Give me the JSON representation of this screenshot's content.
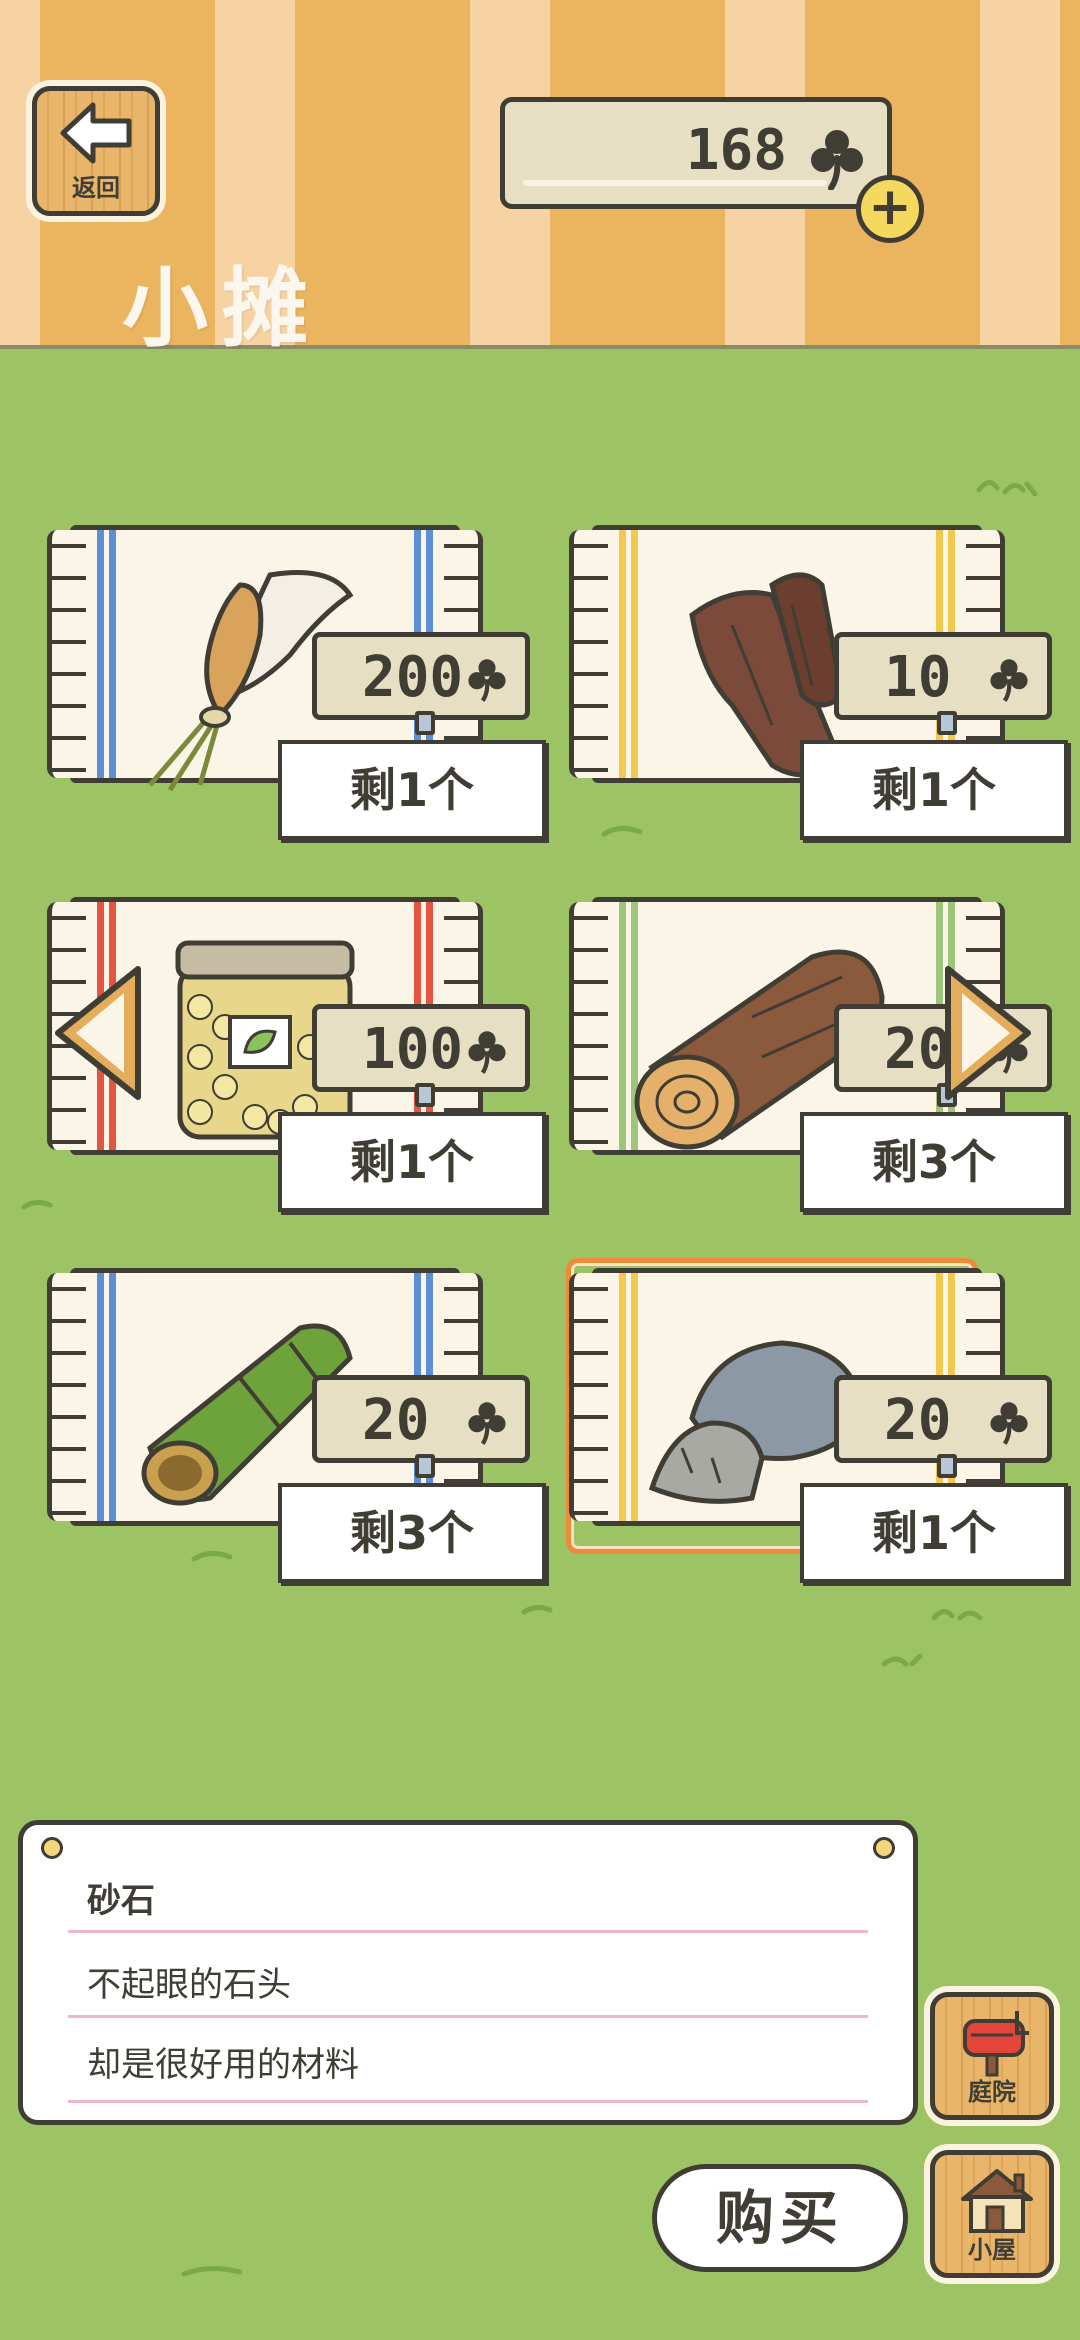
{
  "header": {
    "back_label": "返回",
    "title": "小摊",
    "currency_value": "168",
    "currency_icon": "clover-icon",
    "add_icon": "plus-icon"
  },
  "items": [
    {
      "name": "item-feather",
      "price": "200",
      "stock": "剩1个",
      "stripe_color": "#5d8fd6",
      "selected": false
    },
    {
      "name": "item-dark-wood",
      "price": "10",
      "stock": "剩1个",
      "stripe_color": "#f2c84f",
      "selected": false
    },
    {
      "name": "item-bean-jar",
      "price": "100",
      "stock": "剩1个",
      "stripe_color": "#e5553f",
      "selected": false
    },
    {
      "name": "item-log",
      "price": "20",
      "stock": "剩3个",
      "stripe_color": "#9cc77a",
      "selected": false
    },
    {
      "name": "item-bamboo",
      "price": "20",
      "stock": "剩3个",
      "stripe_color": "#5d8fd6",
      "selected": false
    },
    {
      "name": "item-stone",
      "price": "20",
      "stock": "剩1个",
      "stripe_color": "#f2c84f",
      "selected": true
    }
  ],
  "description": {
    "name": "砂石",
    "line1": "不起眼的石头",
    "line2": "却是很好用的材料"
  },
  "buttons": {
    "buy": "购买",
    "yard": "庭院",
    "house": "小屋"
  },
  "colors": {
    "grass": "#9cc465",
    "header_orange": "#ebb55f",
    "header_light": "#f7d3a4",
    "selection": "#ef8a3a",
    "outline": "#3f3d34"
  }
}
